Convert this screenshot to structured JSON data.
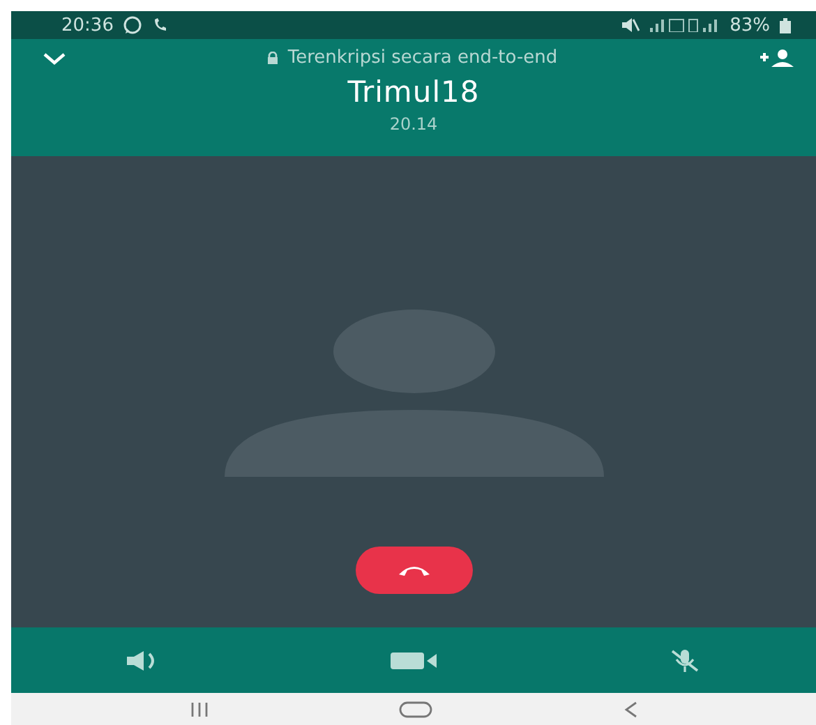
{
  "status_bar": {
    "time": "20:36",
    "battery": "83%"
  },
  "header": {
    "encryption_note": "Terenkripsi secara end-to-end",
    "contact_name": "Trimul18",
    "duration": "20.14"
  }
}
